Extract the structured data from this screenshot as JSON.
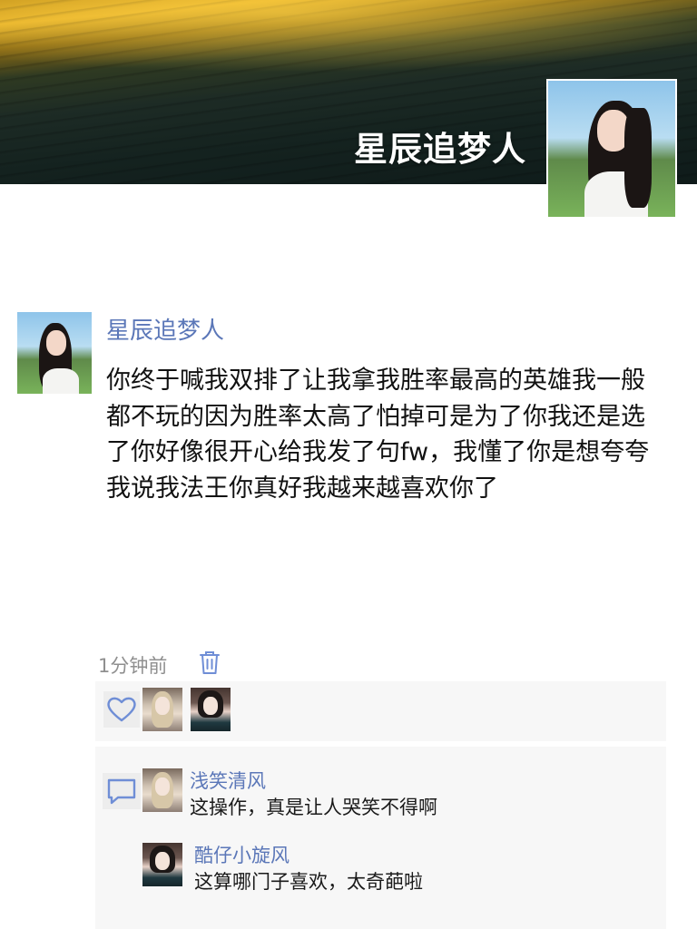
{
  "profile": {
    "name": "星辰追梦人"
  },
  "post": {
    "author": "星辰追梦人",
    "text": "你终于喊我双排了让我拿我胜率最高的英雄我一般都不玩的因为胜率太高了怕掉可是为了你我还是选了你好像很开心给我发了句fw，我懂了你是想夸夸我说我法王你真好我越来越喜欢你了",
    "time": "1分钟前"
  },
  "likes": {
    "icon": "heart-icon",
    "avatars": [
      "liker-avatar-1",
      "liker-avatar-2"
    ]
  },
  "comments": [
    {
      "name": "浅笑清风",
      "text": "这操作，真是让人哭笑不得啊"
    },
    {
      "name": "酷仔小旋风",
      "text": "这算哪门子喜欢，太奇葩啦"
    }
  ],
  "colors": {
    "link": "#5b77b8",
    "panel": "#f7f7f7",
    "meta": "#8f8f8f"
  }
}
